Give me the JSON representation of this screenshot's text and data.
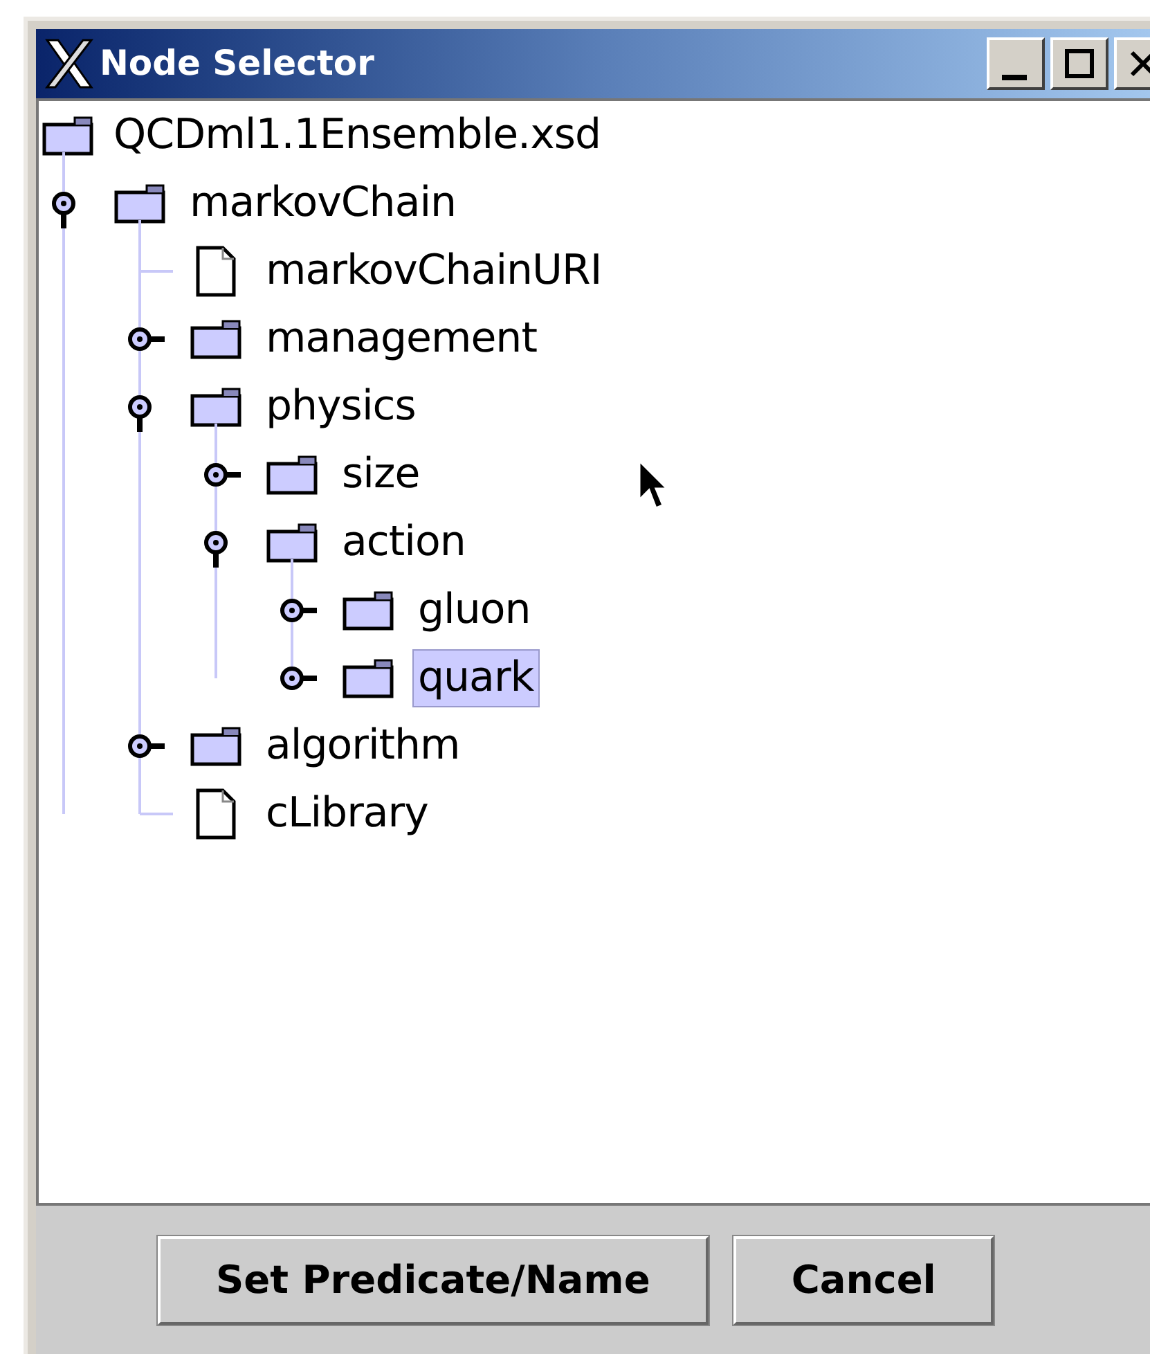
{
  "window": {
    "title": "Node Selector"
  },
  "tree": {
    "label": "QCDml1.1Ensemble.xsd",
    "kind": "folder",
    "selected": false,
    "children": [
      {
        "label": "markovChain",
        "kind": "folder",
        "expanded": true,
        "selected": false,
        "children": [
          {
            "label": "markovChainURI",
            "kind": "file",
            "selected": false
          },
          {
            "label": "management",
            "kind": "folder",
            "expanded": false,
            "selected": false
          },
          {
            "label": "physics",
            "kind": "folder",
            "expanded": true,
            "selected": false,
            "children": [
              {
                "label": "size",
                "kind": "folder",
                "expanded": false,
                "selected": false
              },
              {
                "label": "action",
                "kind": "folder",
                "expanded": true,
                "selected": false,
                "children": [
                  {
                    "label": "gluon",
                    "kind": "folder",
                    "expanded": false,
                    "selected": false
                  },
                  {
                    "label": "quark",
                    "kind": "folder",
                    "expanded": false,
                    "selected": true
                  }
                ]
              }
            ]
          },
          {
            "label": "algorithm",
            "kind": "folder",
            "expanded": false,
            "selected": false
          },
          {
            "label": "cLibrary",
            "kind": "file",
            "selected": false
          }
        ]
      }
    ]
  },
  "buttons": [
    "Set Predicate/Name",
    "Cancel"
  ]
}
